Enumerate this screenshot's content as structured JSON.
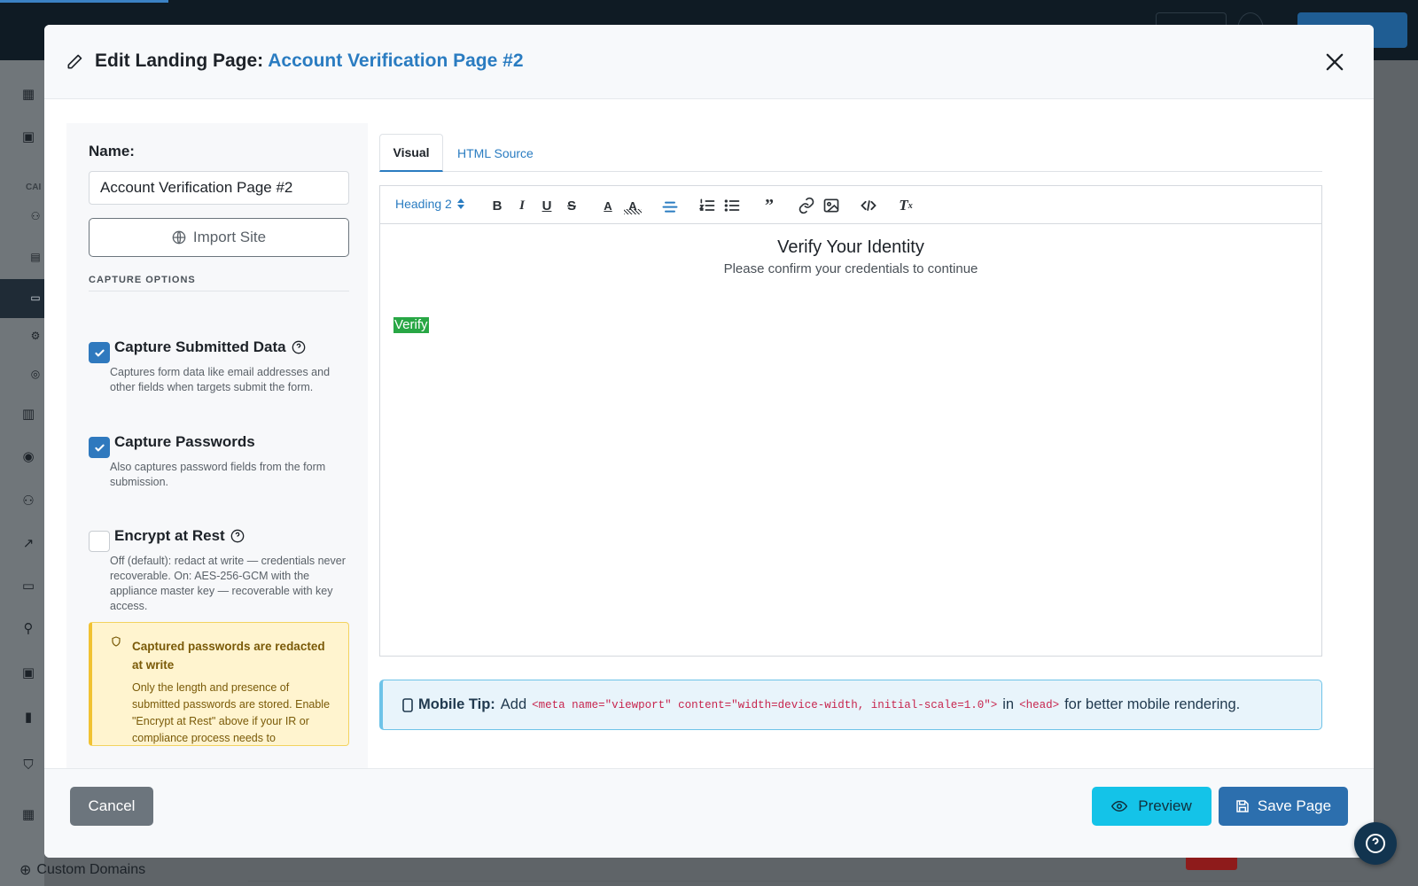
{
  "background": {
    "category_label": "CAI",
    "bottom_link": "Custom Domains"
  },
  "modal": {
    "title_prefix": "Edit Landing Page:",
    "title_name": "Account Verification Page #2"
  },
  "form": {
    "name_label": "Name:",
    "name_value": "Account Verification Page #2",
    "import_label": "Import Site",
    "section_label": "CAPTURE OPTIONS",
    "options": [
      {
        "title": "Capture Submitted Data",
        "checked": true,
        "has_help": true,
        "desc": "Captures form data like email addresses and other fields when targets submit the form."
      },
      {
        "title": "Capture Passwords",
        "checked": true,
        "has_help": false,
        "desc": "Also captures password fields from the form submission."
      },
      {
        "title": "Encrypt at Rest",
        "checked": false,
        "has_help": true,
        "desc": "Off (default): redact at write — credentials never recoverable. On: AES-256-GCM with the appliance master key — recoverable with key access."
      }
    ],
    "warning": {
      "title": "Captured passwords are redacted at write",
      "body": "Only the length and presence of submitted passwords are stored. Enable \"Encrypt at Rest\" above if your IR or compliance process needs to"
    }
  },
  "editor": {
    "tabs": [
      {
        "label": "Visual",
        "active": true
      },
      {
        "label": "HTML Source",
        "active": false
      }
    ],
    "heading_select": "Heading 2",
    "toolbar_icons": [
      "bold-icon",
      "italic-icon",
      "underline-icon",
      "strikethrough-icon",
      "text-color-icon",
      "highlight-icon",
      "align-center-icon",
      "ordered-list-icon",
      "bullet-list-icon",
      "quote-icon",
      "link-icon",
      "image-icon",
      "code-icon",
      "clear-format-icon"
    ],
    "content": {
      "heading": "Verify Your Identity",
      "subtitle": "Please confirm your credentials to continue",
      "verify_button": "Verify"
    }
  },
  "tip": {
    "label": "Mobile Tip:",
    "add": "Add",
    "code_meta": "<meta name=\"viewport\" content=\"width=device-width, initial-scale=1.0\">",
    "in": "in",
    "code_head": "<head>",
    "suffix": "for better mobile rendering."
  },
  "footer": {
    "cancel": "Cancel",
    "preview": "Preview",
    "save": "Save Page"
  },
  "colors": {
    "accent": "#2a7cc1",
    "save_button": "#2c6fae",
    "preview_button": "#14c3e8",
    "cancel_button": "#6c757d",
    "warning_bg": "#fff4cf",
    "verify_bg": "#28a745"
  }
}
